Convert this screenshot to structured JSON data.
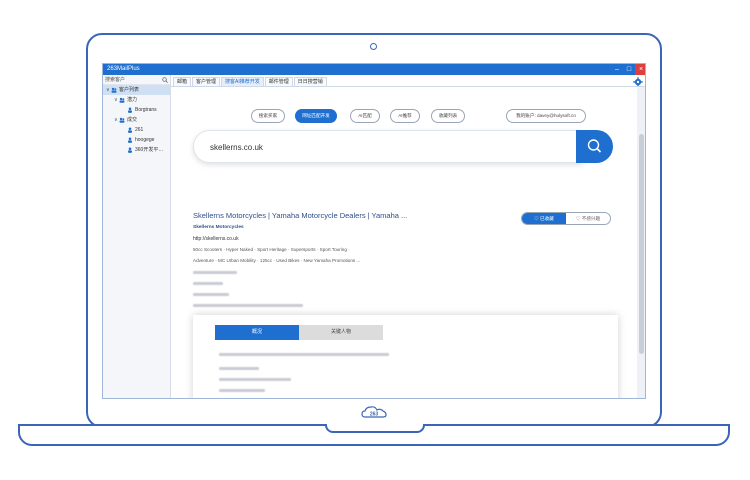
{
  "window": {
    "title": "263MailPlus",
    "controls": [
      "–",
      "□",
      "×"
    ]
  },
  "brand_colors": {
    "accent": "#1e6fd0",
    "frame": "#3b66b8"
  },
  "sidebar": {
    "search_label": "搜索客户",
    "tree": [
      {
        "label": "客户列表",
        "level": 0,
        "selected": true
      },
      {
        "label": "潜力",
        "level": 1
      },
      {
        "label": "Borgtrans",
        "level": 2
      },
      {
        "label": "成交",
        "level": 1
      },
      {
        "label": "261",
        "level": 2
      },
      {
        "label": "hoogege",
        "level": 2
      },
      {
        "label": "360开发平…",
        "level": 2
      }
    ]
  },
  "tabs": [
    "邮箱",
    "客户管理",
    "搜客AI推荐开发",
    "邮件管理",
    "日日搜营销"
  ],
  "filters": {
    "pills": [
      "搜索买家",
      "网址匹配开发",
      "AI匹配",
      "AI推荐",
      "收藏列表"
    ],
    "account": "我的账户: davey@hulysoft.cn"
  },
  "search": {
    "value": "skellerns.co.uk",
    "placeholder": ""
  },
  "result": {
    "title": "Skellerns Motorcycles | Yamaha Motorcycle Dealers | Yamaha ...",
    "company": "Skellerns Motorcycles",
    "url": "http://skellerns.co.uk",
    "tags_line1": "50cc Scooters · Hyper Naked · Sport Heritage · Supersports · Sport Touring ·",
    "tags_line2": "Adventure · MC Urban Mobility · 125cc · Used Bikes · New Yamaha Promotions ...",
    "toggle": [
      "已收藏",
      "不感兴趣"
    ]
  },
  "card": {
    "tabs": [
      "概况",
      "关键人物"
    ]
  },
  "bezel_logo_text": "263"
}
